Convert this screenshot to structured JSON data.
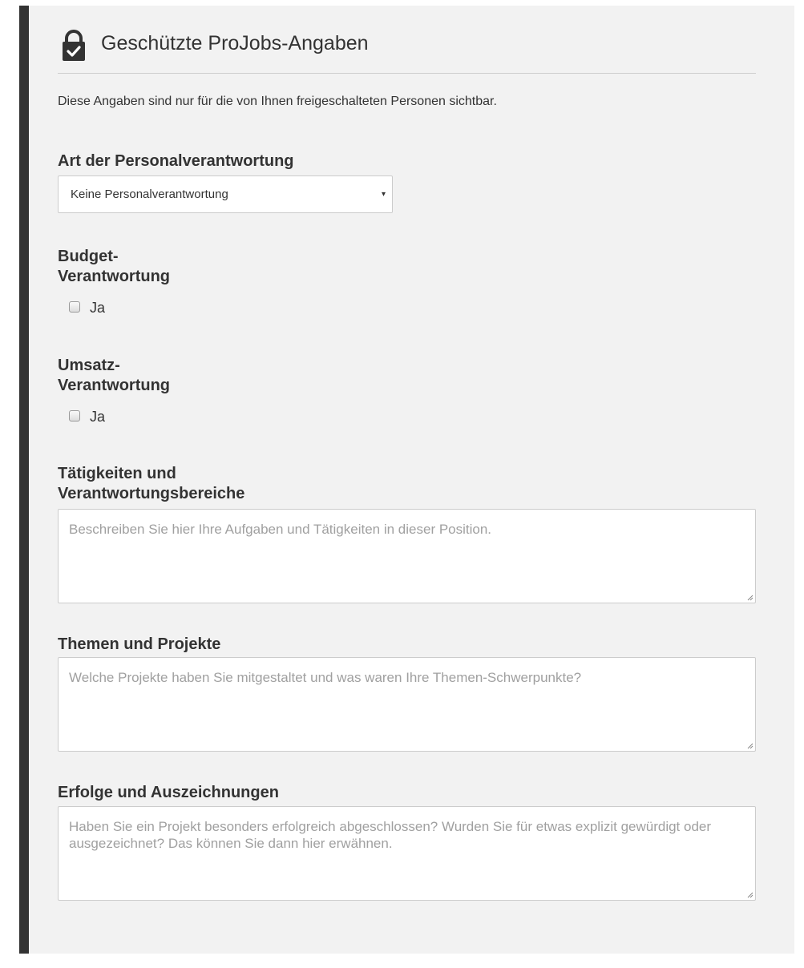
{
  "header": {
    "title": "Geschützte ProJobs-Angaben",
    "icon": "lock-check-icon"
  },
  "intro": "Diese Angaben sind nur für die von Ihnen freigeschalteten Personen sichtbar.",
  "personnel": {
    "label": "Art der Personalverantwortung",
    "selected": "Keine Personalverantwortung",
    "arrow": "▾"
  },
  "budget": {
    "label_line1": "Budget-",
    "label_line2": "Verantwortung",
    "option": "Ja",
    "checked": false
  },
  "revenue": {
    "label_line1": "Umsatz-",
    "label_line2": "Verantwortung",
    "option": "Ja",
    "checked": false
  },
  "tasks": {
    "label_line1": "Tätigkeiten und",
    "label_line2": "Verantwortungsbereiche",
    "placeholder": "Beschreiben Sie hier Ihre Aufgaben und Tätigkeiten in dieser Position."
  },
  "projects": {
    "label": "Themen und Projekte",
    "placeholder": "Welche Projekte haben Sie mitgestaltet und was waren Ihre Themen-Schwerpunkte?"
  },
  "achievements": {
    "label": "Erfolge und Auszeichnungen",
    "placeholder": "Haben Sie ein Projekt besonders erfolgreich abgeschlossen? Wurden Sie für etwas explizit gewürdigt oder ausgezeichnet? Das können Sie dann hier erwähnen."
  },
  "colors": {
    "panel": "#f2f2f2",
    "accent_bar": "#333333",
    "placeholder": "#a0a0a0"
  }
}
